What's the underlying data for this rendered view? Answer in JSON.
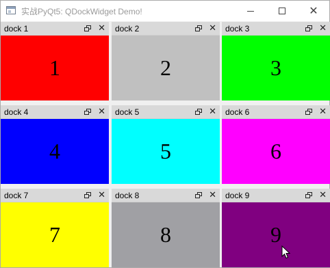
{
  "window": {
    "title": "实战PyQt5: QDockWidget Demo!",
    "icon": "app-window-icon",
    "controls": [
      "minimize-icon",
      "maximize-icon",
      "close-icon"
    ]
  },
  "docks": [
    {
      "title": "dock 1",
      "label": "1",
      "color": "#ff0000"
    },
    {
      "title": "dock 2",
      "label": "2",
      "color": "#c0c0c0"
    },
    {
      "title": "dock 3",
      "label": "3",
      "color": "#00ff00"
    },
    {
      "title": "dock 4",
      "label": "4",
      "color": "#0000ff"
    },
    {
      "title": "dock 5",
      "label": "5",
      "color": "#00ffff"
    },
    {
      "title": "dock 6",
      "label": "6",
      "color": "#ff00ff"
    },
    {
      "title": "dock 7",
      "label": "7",
      "color": "#ffff00"
    },
    {
      "title": "dock 8",
      "label": "8",
      "color": "#a0a0a4"
    },
    {
      "title": "dock 9",
      "label": "9",
      "color": "#800080"
    }
  ],
  "dock_buttons": {
    "float": "float-icon",
    "close": "close-icon"
  }
}
